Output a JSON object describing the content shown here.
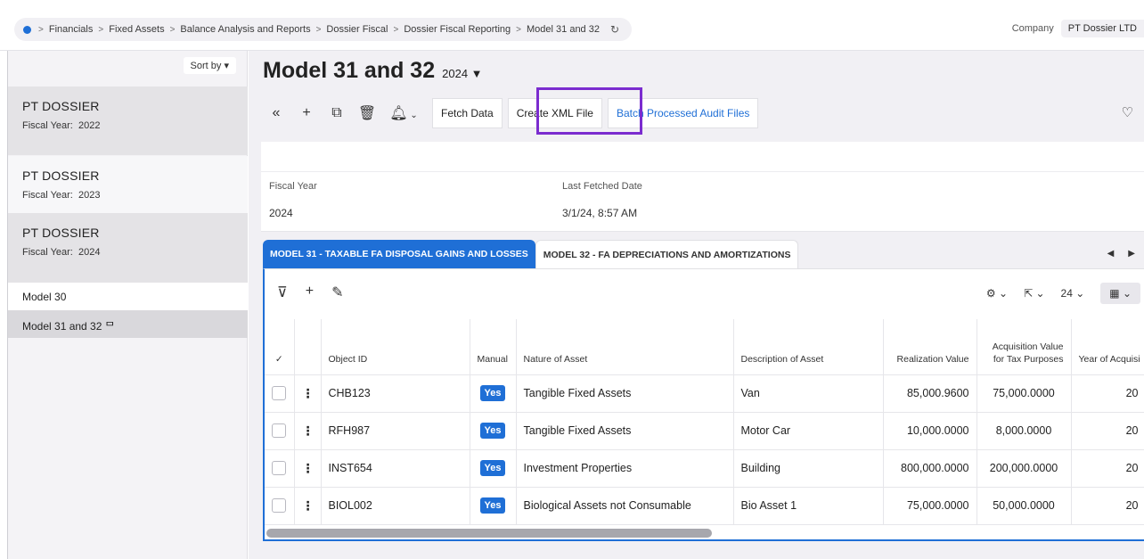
{
  "breadcrumb": {
    "items": [
      "Financials",
      "Fixed Assets",
      "Balance Analysis and Reports",
      "Dossier Fiscal",
      "Dossier Fiscal Reporting",
      "Model 31 and 32"
    ],
    "separator": ">"
  },
  "company": {
    "label": "Company",
    "value": "PT Dossier LTD"
  },
  "sidebar": {
    "sort_label": "Sort by",
    "dossiers": [
      {
        "name": "PT DOSSIER",
        "fiscal_label": "Fiscal Year:",
        "year": "2022"
      },
      {
        "name": "PT DOSSIER",
        "fiscal_label": "Fiscal Year:",
        "year": "2023"
      },
      {
        "name": "PT DOSSIER",
        "fiscal_label": "Fiscal Year:",
        "year": "2024"
      }
    ],
    "items": [
      {
        "label": "Model 30"
      },
      {
        "label": "Model 31 and 32 ᄆ"
      }
    ]
  },
  "page": {
    "title": "Model 31 and 32",
    "year": "2024"
  },
  "toolbar": {
    "fetch_label": "Fetch Data",
    "create_xml_label": "Create XML File",
    "batch_label": "Batch Processed Audit Files"
  },
  "info": {
    "fiscal_year_label": "Fiscal Year",
    "fiscal_year_value": "2024",
    "last_fetched_label": "Last Fetched Date",
    "last_fetched_value": "3/1/24, 8:57 AM"
  },
  "tabs": [
    {
      "label": "MODEL 31 - TAXABLE FA DISPOSAL GAINS AND LOSSES"
    },
    {
      "label": "MODEL 32 - FA DEPRECIATIONS AND AMORTIZATIONS"
    }
  ],
  "grid": {
    "page_size": "24",
    "columns": {
      "check": "✓",
      "object_id": "Object ID",
      "manual": "Manual",
      "nature": "Nature of Asset",
      "description": "Description of Asset",
      "realization": "Realization Value",
      "acq_line1": "Acquisition Value",
      "acq_line2": "for Tax Purposes",
      "year_acq": "Year of Acquisi"
    },
    "rows": [
      {
        "object_id": "CHB123",
        "manual": "Yes",
        "nature": "Tangible Fixed Assets",
        "description": "Van",
        "realization": "85,000.9600",
        "acquisition": "75,000.0000",
        "year": "20"
      },
      {
        "object_id": "RFH987",
        "manual": "Yes",
        "nature": "Tangible Fixed Assets",
        "description": "Motor Car",
        "realization": "10,000.0000",
        "acquisition": "8,000.0000",
        "year": "20"
      },
      {
        "object_id": "INST654",
        "manual": "Yes",
        "nature": "Investment Properties",
        "description": "Building",
        "realization": "800,000.0000",
        "acquisition": "200,000.0000",
        "year": "20"
      },
      {
        "object_id": "BIOL002",
        "manual": "Yes",
        "nature": "Biological Assets not Consumable",
        "description": "Bio Asset 1",
        "realization": "75,000.0000",
        "acquisition": "50,000.0000",
        "year": "20"
      }
    ]
  }
}
